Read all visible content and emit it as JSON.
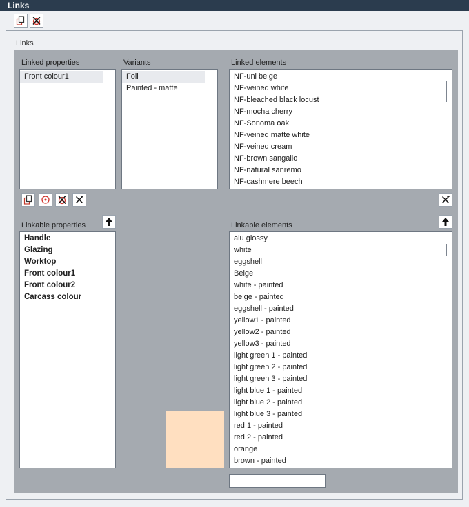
{
  "window": {
    "title": "Links"
  },
  "panel": {
    "label": "Links"
  },
  "linked_properties": {
    "label": "Linked properties",
    "items": [
      "Front colour1"
    ]
  },
  "variants": {
    "label": "Variants",
    "items": [
      "Foil",
      "Painted - matte"
    ]
  },
  "linked_elements": {
    "label": "Linked elements",
    "items": [
      "NF-uni beige",
      "NF-veined white",
      "NF-bleached black locust",
      "NF-mocha cherry",
      "NF-Sonoma oak",
      "NF-veined matte white",
      "NF-veined cream",
      "NF-brown sangallo",
      "NF-natural sanremo",
      "NF-cashmere beech"
    ]
  },
  "linkable_properties": {
    "label": "Linkable properties",
    "items": [
      "Handle",
      "Glazing",
      "Worktop",
      "Front colour1",
      "Front colour2",
      "Carcass colour"
    ]
  },
  "linkable_elements": {
    "label": "Linkable elements",
    "items": [
      "alu glossy",
      "white",
      "eggshell",
      "Beige",
      "white - painted",
      "beige - painted",
      "eggshell - painted",
      "yellow1 - painted",
      "yellow2 - painted",
      "yellow3 - painted",
      "light green 1 - painted",
      "light green 2 - painted",
      "light green 3 - painted",
      "light blue 1 - painted",
      "light blue 2 - painted",
      "light blue 3 - painted",
      "red 1 - painted",
      "red 2 - painted",
      "orange",
      "brown - painted"
    ]
  },
  "colors": {
    "swatch": "#ffdfc0",
    "accent_red": "#d0342c"
  },
  "search": {
    "value": ""
  }
}
